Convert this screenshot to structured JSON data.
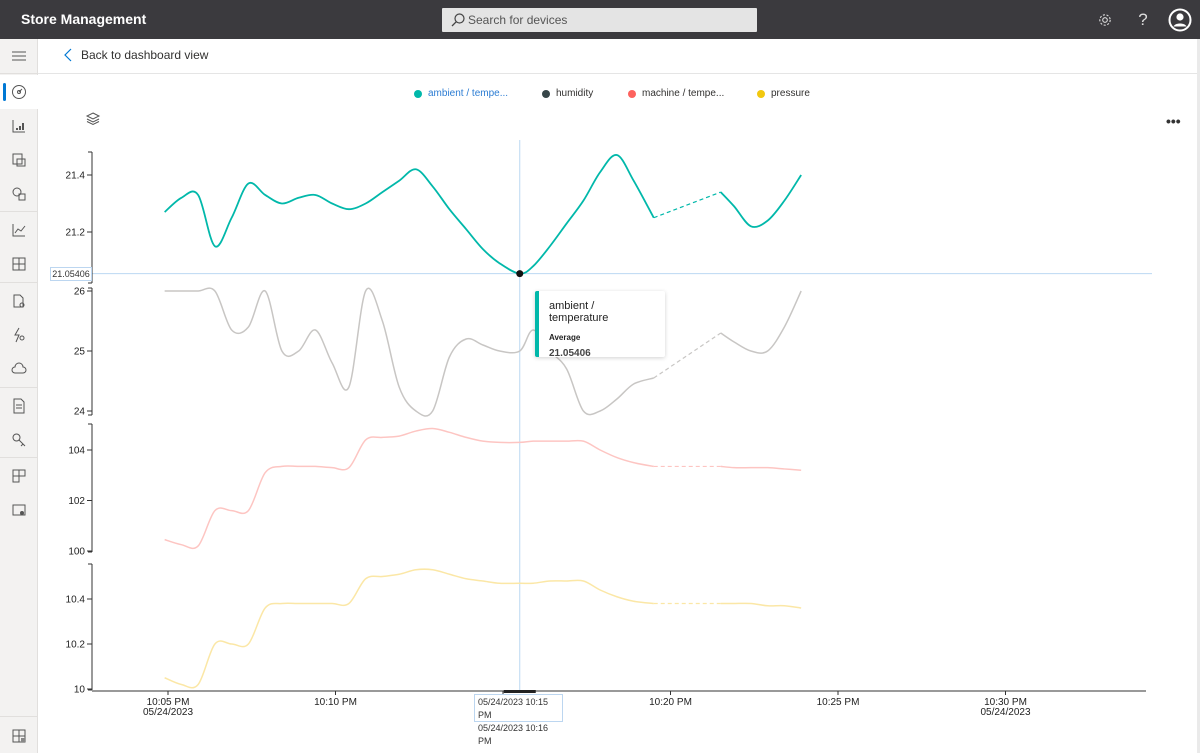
{
  "header": {
    "app_title": "Store Management",
    "search_placeholder": "Search for devices",
    "icons": [
      "gear-icon",
      "help-icon",
      "account-icon"
    ],
    "help_glyph": "?"
  },
  "sidebar": {
    "items": [
      {
        "name": "menu-icon"
      },
      {
        "name": "dashboard-icon",
        "active": true
      },
      {
        "name": "devices-icon"
      },
      {
        "name": "device-groups-icon"
      },
      {
        "name": "device-templates-icon"
      },
      {
        "name": "analytics-icon"
      },
      {
        "name": "dashboards-icon"
      },
      {
        "name": "jobs-icon"
      },
      {
        "name": "rules-icon"
      },
      {
        "name": "data-export-icon"
      },
      {
        "name": "audit-logs-icon"
      },
      {
        "name": "permissions-icon"
      },
      {
        "name": "application-icon"
      },
      {
        "name": "customization-icon"
      },
      {
        "name": "iot-central-home-icon"
      }
    ]
  },
  "subheader": {
    "back_label": "Back to dashboard view"
  },
  "legend": [
    {
      "label": "ambient / tempe...",
      "color": "#01b8aa",
      "active": true
    },
    {
      "label": "humidity",
      "color": "#374649"
    },
    {
      "label": "machine / tempe...",
      "color": "#fd625e"
    },
    {
      "label": "pressure",
      "color": "#f2c80f"
    }
  ],
  "toolbar": {
    "more_label": "•••"
  },
  "tooltip": {
    "title": "ambient / temperature",
    "label": "Average",
    "value": "21.05406"
  },
  "cursor": {
    "y_readout": "21.05406",
    "x_readout_1": "05/24/2023 10:15 PM",
    "x_readout_2": "05/24/2023 10:16 PM"
  },
  "chart_data": {
    "type": "line",
    "title": "",
    "xlabel": "",
    "x_unit": "minutes after 22:00 on 05/24/2023",
    "x_ticks": [
      {
        "value": 5,
        "label": "10:05 PM",
        "sublabel": "05/24/2023"
      },
      {
        "value": 10,
        "label": "10:10 PM",
        "sublabel": ""
      },
      {
        "value": 15,
        "label": "",
        "sublabel": ""
      },
      {
        "value": 20,
        "label": "10:20 PM",
        "sublabel": ""
      },
      {
        "value": 25,
        "label": "10:25 PM",
        "sublabel": ""
      },
      {
        "value": 30,
        "label": "10:30 PM",
        "sublabel": "05/24/2023"
      }
    ],
    "xlim": [
      4.4,
      34.2
    ],
    "cursor_x": 15.5,
    "gap": [
      19.5,
      21.5
    ],
    "x": [
      4.9,
      5.4,
      5.9,
      6.4,
      6.9,
      7.4,
      7.9,
      8.4,
      8.9,
      9.4,
      9.9,
      10.4,
      10.9,
      11.4,
      11.9,
      12.4,
      12.9,
      13.4,
      13.9,
      14.4,
      14.9,
      15.5,
      15.9,
      16.4,
      16.9,
      17.4,
      17.9,
      18.4,
      18.9,
      19.5,
      21.5,
      21.9,
      22.4,
      22.9,
      23.4,
      23.9
    ],
    "series": [
      {
        "name": "ambient / temperature",
        "color": "#01b8aa",
        "ylim": [
          21.0,
          21.48
        ],
        "yticks": [
          21.2,
          21.4
        ],
        "values": [
          21.27,
          21.32,
          21.33,
          21.15,
          21.25,
          21.37,
          21.33,
          21.3,
          21.32,
          21.33,
          21.3,
          21.28,
          21.3,
          21.34,
          21.38,
          21.42,
          21.36,
          21.28,
          21.21,
          21.14,
          21.09,
          21.054,
          21.08,
          21.15,
          21.23,
          21.31,
          21.41,
          21.47,
          21.38,
          21.25,
          21.34,
          21.29,
          21.22,
          21.24,
          21.31,
          21.4
        ]
      },
      {
        "name": "humidity",
        "color": "#c8c6c4",
        "ylim": [
          23.9,
          26.0
        ],
        "yticks": [
          24,
          25,
          26
        ],
        "values": [
          26.0,
          26.0,
          26.0,
          26.0,
          25.35,
          25.4,
          26.0,
          25.0,
          25.0,
          25.35,
          24.8,
          24.4,
          26.0,
          25.5,
          24.4,
          24.0,
          24.0,
          24.9,
          25.2,
          25.1,
          25.0,
          25.0,
          25.35,
          25.0,
          24.7,
          24.0,
          24.0,
          24.2,
          24.45,
          24.55,
          25.3,
          25.15,
          25.0,
          25.0,
          25.4,
          26.0
        ]
      },
      {
        "name": "machine / temperature",
        "color": "#fdc5c2",
        "ylim": [
          100.0,
          104.9
        ],
        "yticks": [
          100,
          102,
          104
        ],
        "values": [
          100.45,
          100.25,
          100.2,
          101.6,
          101.6,
          101.6,
          103.1,
          103.35,
          103.35,
          103.35,
          103.3,
          103.3,
          104.4,
          104.5,
          104.55,
          104.75,
          104.85,
          104.7,
          104.5,
          104.35,
          104.3,
          104.3,
          104.35,
          104.35,
          104.35,
          104.35,
          104.0,
          103.7,
          103.5,
          103.35,
          103.35,
          103.3,
          103.3,
          103.3,
          103.25,
          103.2
        ]
      },
      {
        "name": "pressure",
        "color": "#fbe7a6",
        "ylim": [
          10.0,
          10.55
        ],
        "yticks": [
          10,
          10.2,
          10.4
        ],
        "values": [
          10.05,
          10.02,
          10.02,
          10.2,
          10.2,
          10.2,
          10.36,
          10.38,
          10.38,
          10.38,
          10.38,
          10.38,
          10.49,
          10.5,
          10.51,
          10.53,
          10.53,
          10.51,
          10.49,
          10.48,
          10.47,
          10.47,
          10.47,
          10.48,
          10.48,
          10.48,
          10.44,
          10.41,
          10.39,
          10.38,
          10.38,
          10.38,
          10.38,
          10.37,
          10.37,
          10.36
        ]
      }
    ]
  }
}
